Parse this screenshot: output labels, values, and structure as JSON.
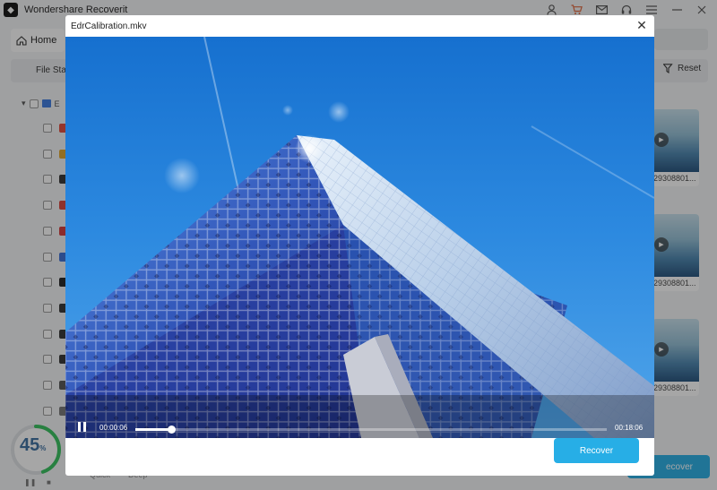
{
  "app": {
    "title": "Wondershare Recoverit",
    "icons": [
      "user-icon",
      "cart-icon",
      "mail-icon",
      "headset-icon",
      "menu-icon",
      "minimize-icon",
      "close-icon"
    ]
  },
  "home_tab": {
    "label": "Home"
  },
  "filter": {
    "file_status": "File Sta",
    "reset_label": "Reset"
  },
  "tree": {
    "root_label": "E",
    "items": [
      {
        "color": "#e24a3b"
      },
      {
        "color": "#e0a52b"
      },
      {
        "color": "#333333"
      },
      {
        "color": "#d9453b"
      },
      {
        "color": "#d63b3b"
      },
      {
        "color": "#3d6fd6"
      },
      {
        "color": "#222222"
      },
      {
        "color": "#333333"
      },
      {
        "color": "#333333"
      },
      {
        "color": "#333333"
      },
      {
        "color": "#555555"
      },
      {
        "color": "#777777"
      }
    ]
  },
  "thumbnails": [
    {
      "name": "29308801..."
    },
    {
      "name": "29308801..."
    },
    {
      "name": "29308801..."
    }
  ],
  "progress": {
    "value": "45",
    "percent_sign": "%"
  },
  "bottom": {
    "quick": "Quick",
    "deep": "Deep",
    "recover_label": "ecover"
  },
  "dialog": {
    "title": "EdrCalibration.mkv",
    "time_current": "00:00:06",
    "time_total": "00:18:06",
    "progress_fraction": 0.076,
    "recover_label": "Recover"
  },
  "colors": {
    "accent": "#27aee6",
    "sky": "#2a88de"
  }
}
